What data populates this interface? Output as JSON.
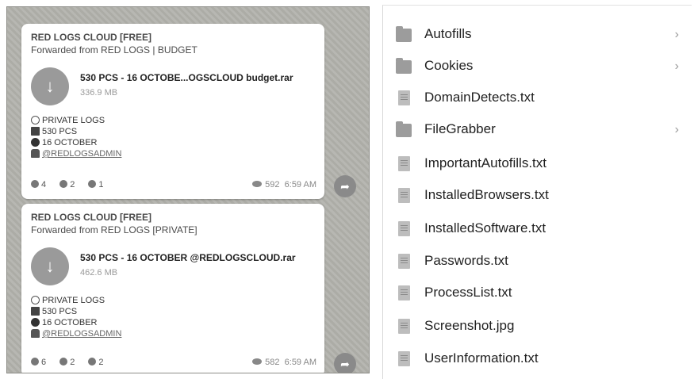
{
  "chat": {
    "messages": [
      {
        "channel": "RED LOGS CLOUD [FREE]",
        "forwarded": "Forwarded from RED LOGS | BUDGET",
        "file_name": "530 PCS - 16 OCTOBE...OGSCLOUD budget.rar",
        "file_size": "336.9 MB",
        "lines": [
          "PRIVATE LOGS",
          "530 PCS",
          "16 OCTOBER",
          "@REDLOGSADMIN"
        ],
        "reactions": [
          "4",
          "2",
          "1"
        ],
        "views": "592",
        "time": "6:59 AM"
      },
      {
        "channel": "RED LOGS CLOUD [FREE]",
        "forwarded": "Forwarded from RED LOGS [PRIVATE]",
        "file_name": "530 PCS - 16 OCTOBER @REDLOGSCLOUD.rar",
        "file_size": "462.6 MB",
        "lines": [
          "PRIVATE LOGS",
          "530 PCS",
          "16 OCTOBER",
          "@REDLOGSADMIN"
        ],
        "reactions": [
          "6",
          "2",
          "2"
        ],
        "views": "582",
        "time": "6:59 AM"
      }
    ]
  },
  "files": [
    {
      "name": "Autofills",
      "type": "folder"
    },
    {
      "name": "Cookies",
      "type": "folder"
    },
    {
      "name": "DomainDetects.txt",
      "type": "file"
    },
    {
      "name": "FileGrabber",
      "type": "folder"
    },
    {
      "name": "ImportantAutofills.txt",
      "type": "file"
    },
    {
      "name": "InstalledBrowsers.txt",
      "type": "file"
    },
    {
      "name": "InstalledSoftware.txt",
      "type": "file"
    },
    {
      "name": "Passwords.txt",
      "type": "file"
    },
    {
      "name": "ProcessList.txt",
      "type": "file"
    },
    {
      "name": "Screenshot.jpg",
      "type": "file"
    },
    {
      "name": "UserInformation.txt",
      "type": "file"
    }
  ],
  "icons": {
    "download": "download-icon",
    "share": "share-icon",
    "folder": "folder-icon",
    "file": "file-icon",
    "chevron": "chevron-right-icon",
    "views": "eye-icon"
  }
}
